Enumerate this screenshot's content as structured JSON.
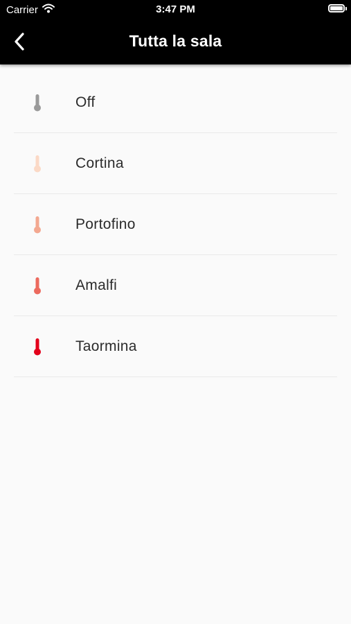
{
  "status_bar": {
    "carrier": "Carrier",
    "time": "3:47 PM",
    "icons": [
      "wifi-icon",
      "battery-icon"
    ]
  },
  "nav": {
    "title": "Tutta la sala",
    "back_icon": "chevron-left-icon"
  },
  "items": [
    {
      "label": "Off",
      "icon": "thermometer-icon",
      "color": "#9a9a9a"
    },
    {
      "label": "Cortina",
      "icon": "thermometer-icon",
      "color": "#fbd9c6"
    },
    {
      "label": "Portofino",
      "icon": "thermometer-icon",
      "color": "#f3a890"
    },
    {
      "label": "Amalfi",
      "icon": "thermometer-icon",
      "color": "#ec6a5e"
    },
    {
      "label": "Taormina",
      "icon": "thermometer-icon",
      "color": "#e3001b"
    }
  ],
  "colors": {
    "bar_background": "#000000",
    "page_background": "#fafafa",
    "divider": "#e9e9e9",
    "text": "#2b2b2b"
  }
}
